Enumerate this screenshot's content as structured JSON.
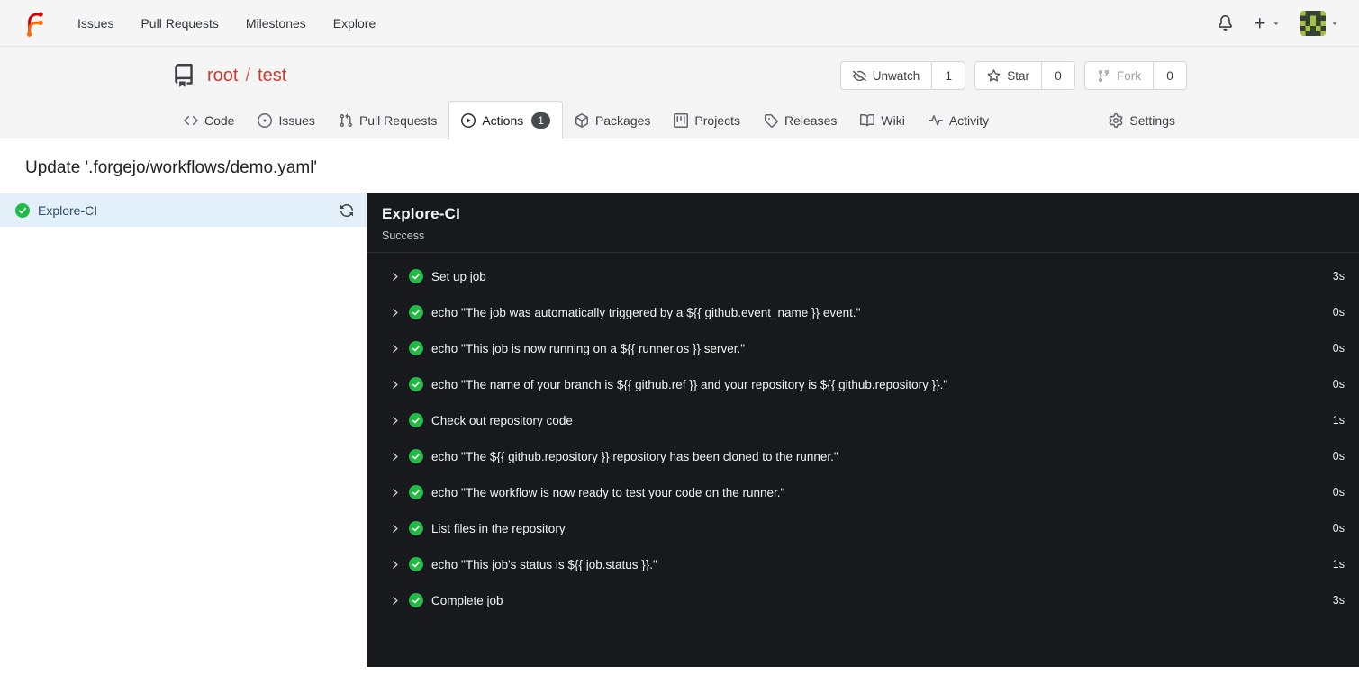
{
  "colors": {
    "primary": "#c23f31",
    "success": "#21ba45",
    "panel_bg": "#17191c"
  },
  "navbar": {
    "links": [
      {
        "label": "Issues"
      },
      {
        "label": "Pull Requests"
      },
      {
        "label": "Milestones"
      },
      {
        "label": "Explore"
      }
    ]
  },
  "repo": {
    "owner": "root",
    "separator": "/",
    "name": "test",
    "watch": {
      "label": "Unwatch",
      "count": "1"
    },
    "star": {
      "label": "Star",
      "count": "0"
    },
    "fork": {
      "label": "Fork",
      "count": "0"
    },
    "tabs": [
      {
        "label": "Code"
      },
      {
        "label": "Issues"
      },
      {
        "label": "Pull Requests"
      },
      {
        "label": "Actions",
        "badge": "1"
      },
      {
        "label": "Packages"
      },
      {
        "label": "Projects"
      },
      {
        "label": "Releases"
      },
      {
        "label": "Wiki"
      },
      {
        "label": "Activity"
      },
      {
        "label": "Settings"
      }
    ]
  },
  "run": {
    "title": "Update '.forgejo/workflows/demo.yaml'",
    "job_list": [
      {
        "name": "Explore-CI",
        "status": "success"
      }
    ],
    "job": {
      "name": "Explore-CI",
      "status": "Success"
    },
    "steps": [
      {
        "label": "Set up job",
        "duration": "3s"
      },
      {
        "label": "echo \"The job was automatically triggered by a ${{ github.event_name }} event.\"",
        "duration": "0s"
      },
      {
        "label": "echo \"This job is now running on a ${{ runner.os }} server.\"",
        "duration": "0s"
      },
      {
        "label": "echo \"The name of your branch is ${{ github.ref }} and your repository is ${{ github.repository }}.\"",
        "duration": "0s"
      },
      {
        "label": "Check out repository code",
        "duration": "1s"
      },
      {
        "label": "echo \"The ${{ github.repository }} repository has been cloned to the runner.\"",
        "duration": "0s"
      },
      {
        "label": "echo \"The workflow is now ready to test your code on the runner.\"",
        "duration": "0s"
      },
      {
        "label": "List files in the repository",
        "duration": "0s"
      },
      {
        "label": "echo \"This job's status is ${{ job.status }}.\"",
        "duration": "1s"
      },
      {
        "label": "Complete job",
        "duration": "3s"
      }
    ]
  }
}
